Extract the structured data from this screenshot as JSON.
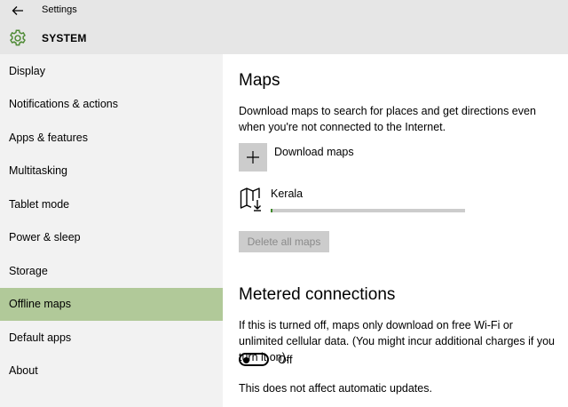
{
  "window": {
    "title": "Settings"
  },
  "header": {
    "section": "SYSTEM"
  },
  "sidebar": {
    "items": [
      {
        "label": "Display"
      },
      {
        "label": "Notifications & actions"
      },
      {
        "label": "Apps & features"
      },
      {
        "label": "Multitasking"
      },
      {
        "label": "Tablet mode"
      },
      {
        "label": "Power & sleep"
      },
      {
        "label": "Storage"
      },
      {
        "label": "Offline maps",
        "active": true
      },
      {
        "label": "Default apps"
      },
      {
        "label": "About"
      }
    ]
  },
  "maps": {
    "heading": "Maps",
    "description": "Download maps to search for places and get directions even when you're not connected to the Internet.",
    "download_label": "Download maps",
    "map_name": "Kerala",
    "download_progress": 0.01,
    "delete_label": "Delete all maps"
  },
  "metered": {
    "heading": "Metered connections",
    "description": "If this is turned off, maps only download on free Wi-Fi or unlimited cellular data. (You might incur additional charges if you turn it on).",
    "toggle_state": "Off",
    "note": "This does not affect automatic updates."
  },
  "colors": {
    "accent": "#b1c999",
    "progress": "#3f8a2a",
    "gear": "#4e8a34"
  },
  "icons": [
    "back-arrow-icon",
    "gear-icon",
    "plus-icon",
    "map-download-icon"
  ]
}
